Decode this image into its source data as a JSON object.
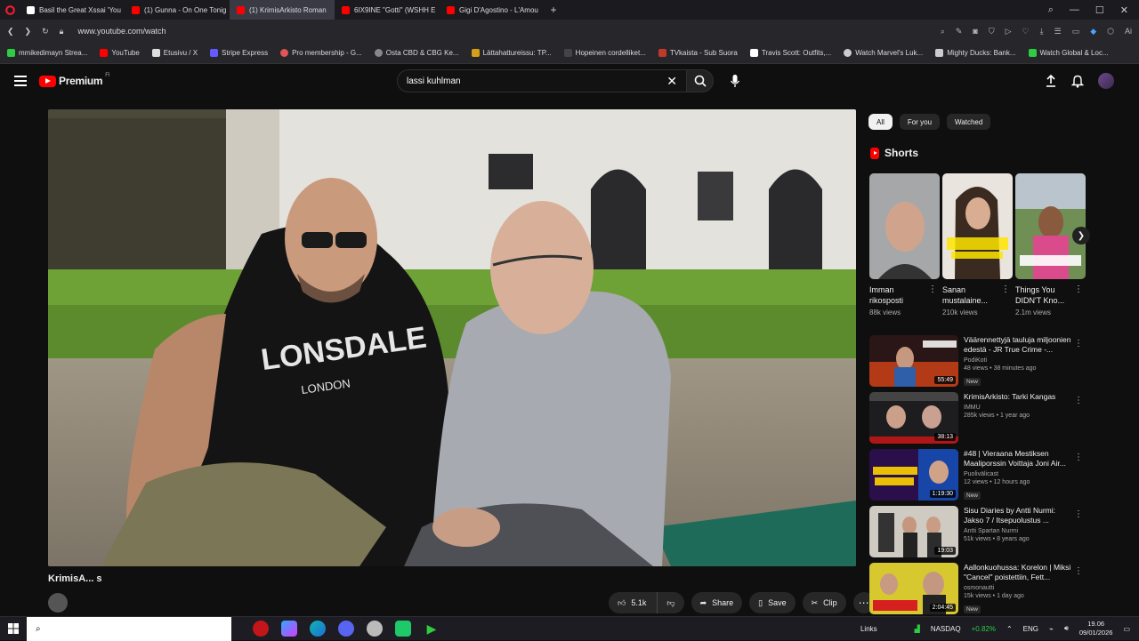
{
  "browser": {
    "tabs": [
      {
        "title": "Basil the Great Xssai 'You",
        "color": "#ffffff"
      },
      {
        "title": "(1) Gunna - On One Tonig",
        "color": "#ff0000"
      },
      {
        "title": "(1) KrimisArkisto Roman",
        "color": "#ff0000"
      },
      {
        "title": "6IX9INE \"Gotti\" (WSHH E",
        "color": "#ff0000"
      },
      {
        "title": "Gigi D'Agostino - L'Amou",
        "color": "#ff0000"
      }
    ],
    "new_tab": "+",
    "url": "www.youtube.com/watch",
    "bookmarks": [
      {
        "label": "mmikedimayn Strea...",
        "color": "#2ecc40"
      },
      {
        "label": "YouTube",
        "color": "#ff0000"
      },
      {
        "label": "Etusivu / X",
        "color": "#dddddd"
      },
      {
        "label": "Stripe Express",
        "color": "#635bff"
      },
      {
        "label": "Pro membership - G...",
        "color": "#e05555"
      },
      {
        "label": "Osta CBD & CBG Ke...",
        "color": "#888888"
      },
      {
        "label": "Lättahattureissu: TP...",
        "color": "#d4a017"
      },
      {
        "label": "Hopeinen cordelliket...",
        "color": "#444444"
      },
      {
        "label": "TVkaista - Sub Suora",
        "color": "#c0392b"
      },
      {
        "label": "Travis Scott: Outfits,...",
        "color": "#ffffff"
      },
      {
        "label": "Watch Marvel's Luk...",
        "color": "#cccccc"
      },
      {
        "label": "Mighty Ducks: Bank...",
        "color": "#cccccc"
      },
      {
        "label": "Watch Global & Loc...",
        "color": "#2ecc40"
      }
    ]
  },
  "youtube": {
    "logo_text": "Premium",
    "logo_country": "FI",
    "search_value": "lassi kuhlman",
    "video": {
      "title": "KrimisA...                                s",
      "likes": "5.1k",
      "share_label": "Share",
      "save_label": "Save",
      "clip_label": "Clip"
    },
    "chips": [
      "All",
      "For you",
      "Watched"
    ],
    "shorts_heading": "Shorts",
    "shorts": [
      {
        "title": "Imman rikosposti",
        "views": "88k views"
      },
      {
        "title": "Sanan mustalaine...",
        "views": "210k views"
      },
      {
        "title": "Things You DIDN'T Kno...",
        "views": "2.1m views"
      }
    ],
    "recommendations": [
      {
        "title": "Väärennettyjä tauluja miljoonien edestä - JR True Crime -...",
        "channel": "PodiKoti",
        "meta": "48 views • 38 minutes ago",
        "badge": "New",
        "duration": "55:49"
      },
      {
        "title": "KrimisArkisto: Tarki Kangas",
        "channel": "IMMU",
        "meta": "285k views • 1 year ago",
        "badge": "",
        "duration": "38:13"
      },
      {
        "title": "#48 | Vieraana Mestiksen Maaliporssin Voittaja Joni Air...",
        "channel": "Puolivälicast",
        "meta": "12 views • 12 hours ago",
        "badge": "New",
        "duration": "1:19:30"
      },
      {
        "title": "Sisu Diaries by Antti Nurmi: Jakso 7 / Itsepuolustus ...",
        "channel": "Antti Spartan Nurmi",
        "meta": "51k views • 8 years ago",
        "badge": "",
        "duration": "19:03"
      },
      {
        "title": "Aallonkuohussa: Korelon | Miksi \"Cancel\" poistettiin, Fett...",
        "channel": "osmonautti",
        "meta": "15k views • 1 day ago",
        "badge": "New",
        "duration": "2:04:45"
      }
    ]
  },
  "taskbar": {
    "links_label": "Links",
    "ticker": "NASDAQ",
    "ticker_change": "+0.82%",
    "lang": "ENG",
    "time": "19.06",
    "date": "09/01/2026"
  }
}
